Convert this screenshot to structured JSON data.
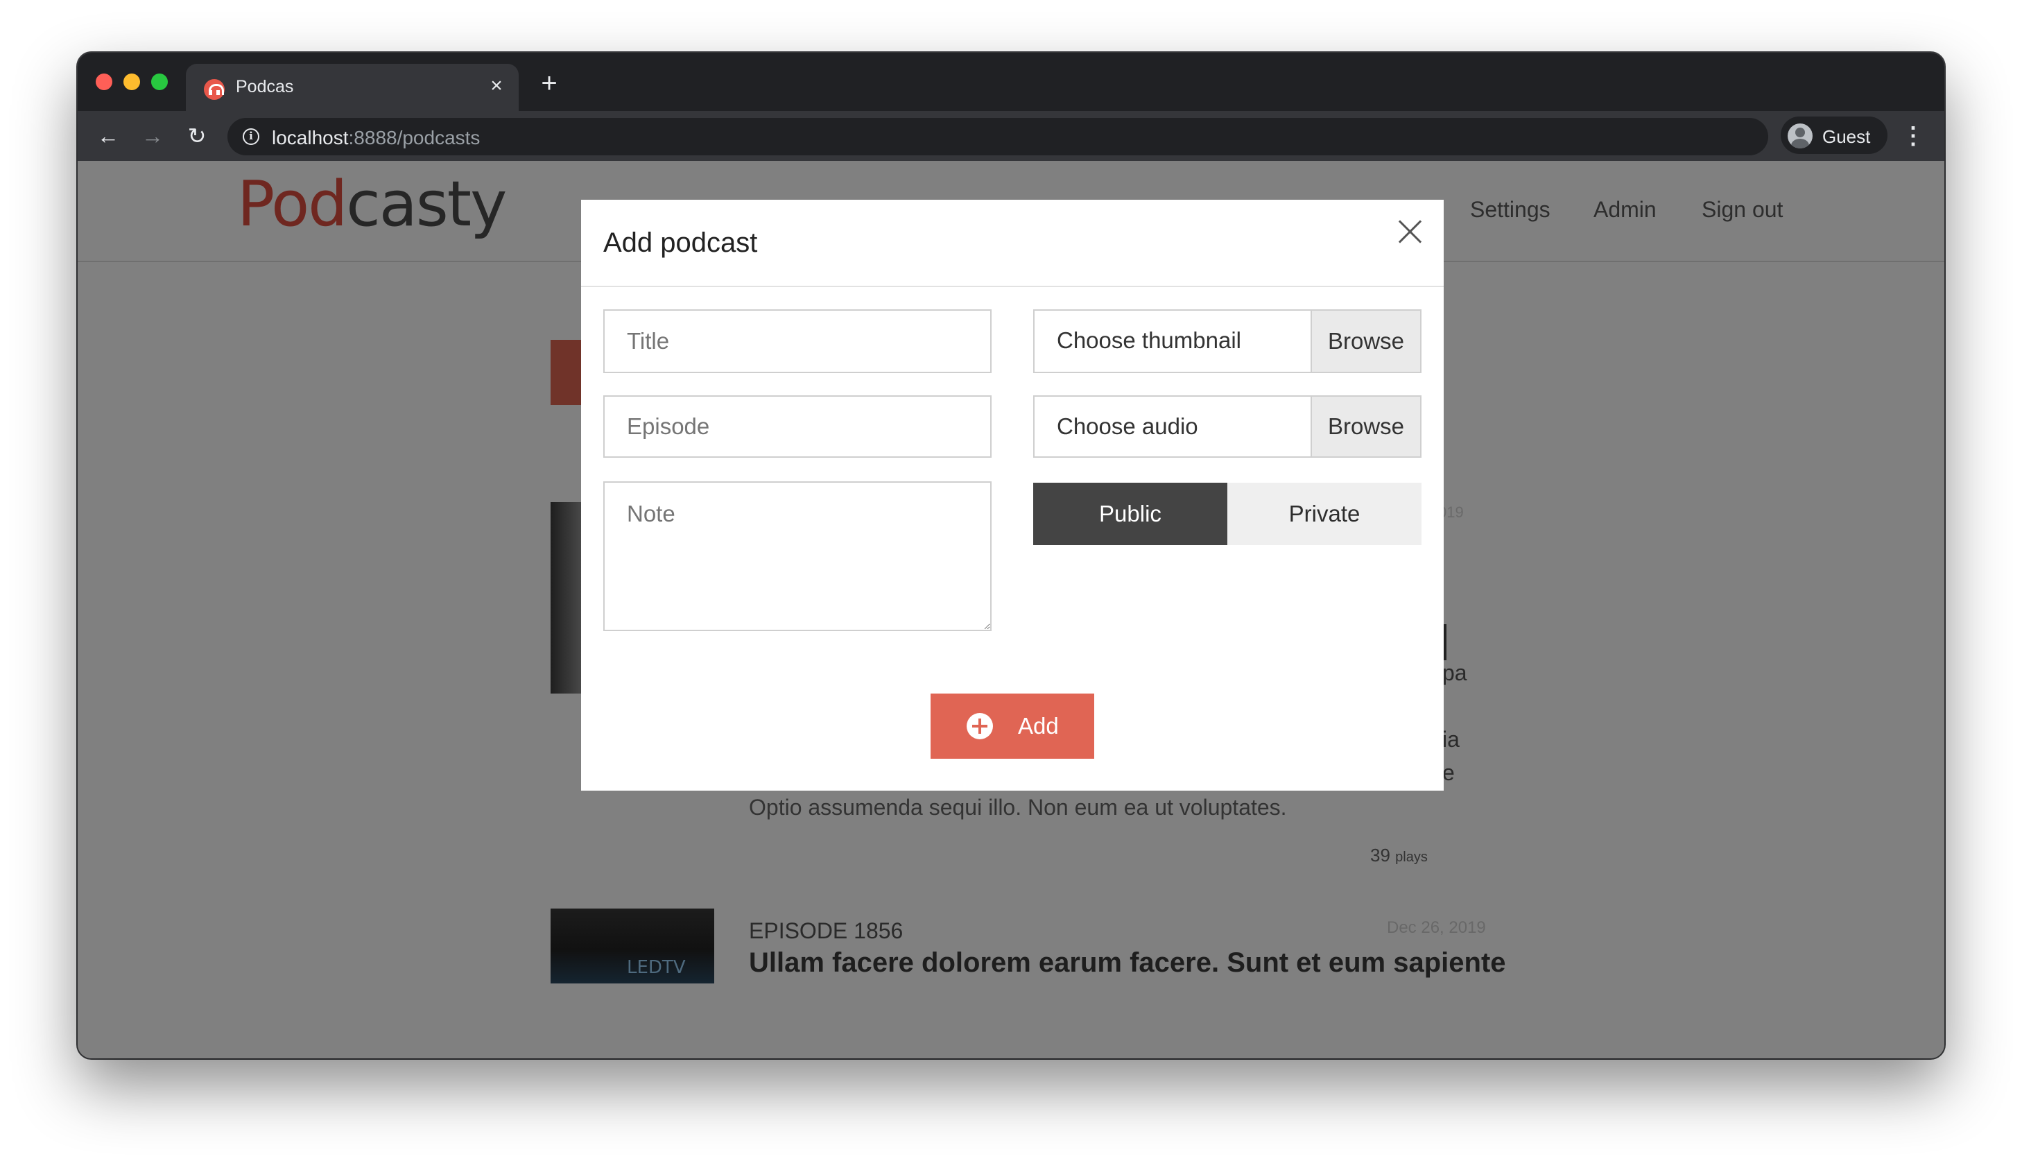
{
  "browser": {
    "tab_title": "Podcas",
    "tab_close": "×",
    "new_tab": "+",
    "url_host": "localhost",
    "url_rest": ":8888/podcasts",
    "profile_label": "Guest",
    "back": "←",
    "forward": "→",
    "reload": "↻",
    "menu": "⋮",
    "info": "i"
  },
  "site": {
    "logo_part1": "Pod",
    "logo_part2": "casty",
    "nav": [
      "Settings",
      "Admin",
      "Sign out"
    ],
    "fragments": [
      "019",
      "pa",
      "ia",
      "e"
    ],
    "description_tail": "Optio assumenda sequi illo. Non eum ea ut voluptates.",
    "plays_count": "39",
    "plays_label": "plays",
    "thumb_text": "LEDTV",
    "episode": {
      "number": "EPISODE 1856",
      "date": "Dec 26, 2019",
      "title": "Ullam facere dolorem earum facere. Sunt et eum sapiente"
    }
  },
  "modal": {
    "title": "Add podcast",
    "title_placeholder": "Title",
    "episode_placeholder": "Episode",
    "note_placeholder": "Note",
    "thumbnail_label": "Choose thumbnail",
    "audio_label": "Choose audio",
    "browse_label": "Browse",
    "visibility": {
      "public": "Public",
      "private": "Private",
      "selected": "Public"
    },
    "add_label": "Add"
  },
  "colors": {
    "accent": "#e06554",
    "toggle_active": "#444444",
    "overlay": "#808080"
  },
  "icons": [
    "close-icon",
    "plus-circle-icon",
    "info-icon",
    "back-icon",
    "forward-icon",
    "reload-icon",
    "profile-icon",
    "kebab-menu-icon",
    "podcast-favicon"
  ]
}
